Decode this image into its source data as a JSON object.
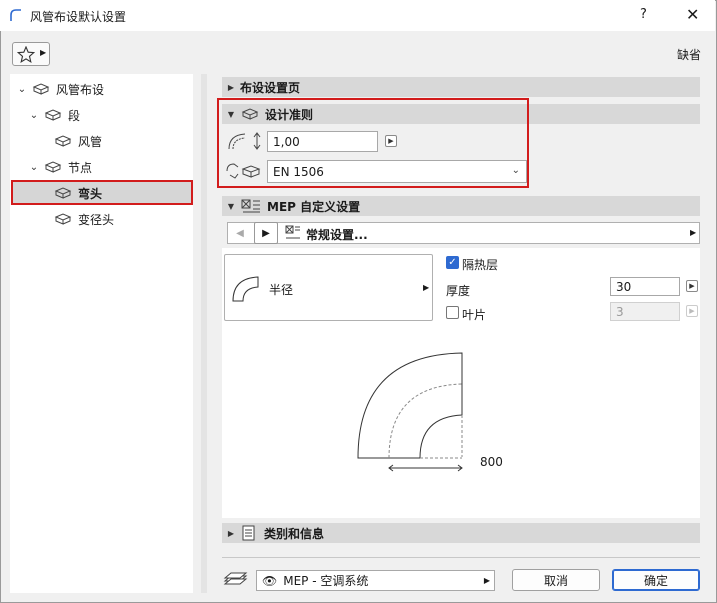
{
  "window": {
    "title": "风管布设默认设置",
    "help": "?",
    "close": "✕"
  },
  "toolbar": {
    "default_label": "缺省"
  },
  "tree": {
    "root": "风管布设",
    "segment": "段",
    "duct": "风管",
    "node": "节点",
    "elbow": "弯头",
    "transition": "变径头"
  },
  "sections": {
    "placement": "布设设置页",
    "design_rules": "设计准则",
    "mep_custom": "MEP 自定义设置",
    "classification": "类别和信息"
  },
  "design_rules": {
    "radius_value": "1,00",
    "standard_value": "EN 1506"
  },
  "mep_nav": {
    "page_label": "常规设置..."
  },
  "elbow": {
    "shape_label": "半径",
    "insulation_label": "隔热层",
    "insulation_checked": true,
    "thickness_label": "厚度",
    "thickness_value": "30",
    "vane_label": "叶片",
    "vane_checked": false,
    "vane_value": "3",
    "dimension_value": "800"
  },
  "footer": {
    "layer_value": "MEP - 空调系统",
    "cancel": "取消",
    "ok": "确定"
  },
  "colors": {
    "highlight_red": "#d21c1c",
    "accent_blue": "#2e6ad1"
  }
}
